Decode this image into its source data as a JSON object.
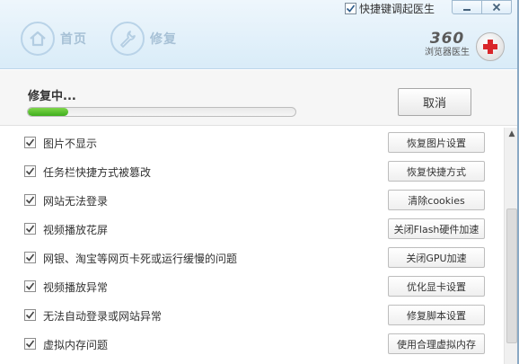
{
  "header": {
    "hotkey_label": "快捷键调起医生",
    "hotkey_checked": true,
    "nav": [
      {
        "label": "首页",
        "icon": "home-icon"
      },
      {
        "label": "修复",
        "icon": "wrench-icon"
      }
    ],
    "brand_number": "360",
    "brand_name": "浏览器医生",
    "brand_icon": "medical-cross-icon"
  },
  "progress": {
    "status_text": "修复中...",
    "fraction": 0.15,
    "cancel_label": "取消",
    "fill_color": "#4fc22a"
  },
  "items": [
    {
      "label": "图片不显示",
      "action": "恢复图片设置",
      "checked": true
    },
    {
      "label": "任务栏快捷方式被篡改",
      "action": "恢复快捷方式",
      "checked": true
    },
    {
      "label": "网站无法登录",
      "action": "清除cookies",
      "checked": true
    },
    {
      "label": "视频播放花屏",
      "action": "关闭Flash硬件加速",
      "checked": true
    },
    {
      "label": "网银、淘宝等网页卡死或运行缓慢的问题",
      "action": "关闭GPU加速",
      "checked": true
    },
    {
      "label": "视频播放异常",
      "action": "优化显卡设置",
      "checked": true
    },
    {
      "label": "无法自动登录或网站异常",
      "action": "修复脚本设置",
      "checked": true
    },
    {
      "label": "虚拟内存问题",
      "action": "使用合理虚拟内存",
      "checked": true
    }
  ]
}
